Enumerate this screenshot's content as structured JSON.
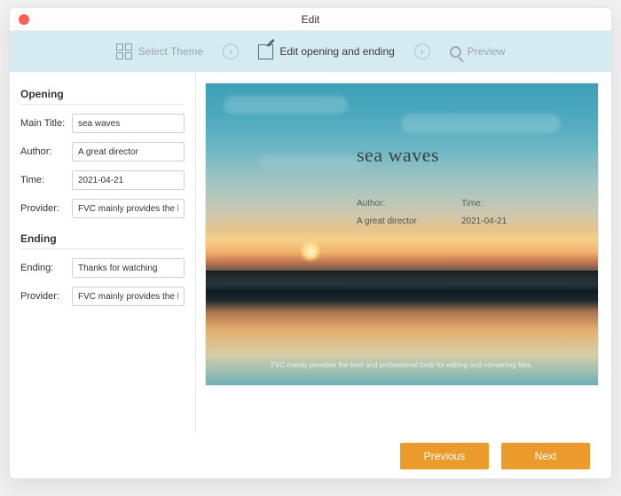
{
  "window": {
    "title": "Edit"
  },
  "steps": {
    "select_theme": "Select Theme",
    "edit_opening_ending": "Edit opening and ending",
    "preview": "Preview"
  },
  "opening": {
    "section": "Opening",
    "main_title_label": "Main Title:",
    "main_title_value": "sea waves",
    "author_label": "Author:",
    "author_value": "A great director",
    "time_label": "Time:",
    "time_value": "2021-04-21",
    "provider_label": "Provider:",
    "provider_value": "FVC mainly provides the best and professional tools for editing and converting files."
  },
  "ending": {
    "section": "Ending",
    "ending_label": "Ending:",
    "ending_value": "Thanks for watching",
    "provider_label": "Provider:",
    "provider_value": "FVC mainly provides the best and professional tools for editing and converting files."
  },
  "preview": {
    "title": "sea waves",
    "author_label": "Author:",
    "time_label": "Time:",
    "author_value": "A great director",
    "time_value": "2021-04-21",
    "provider_line": "FVC mainly provides the best and professional tools for editing and converting files."
  },
  "footer": {
    "previous": "Previous",
    "next": "Next"
  }
}
